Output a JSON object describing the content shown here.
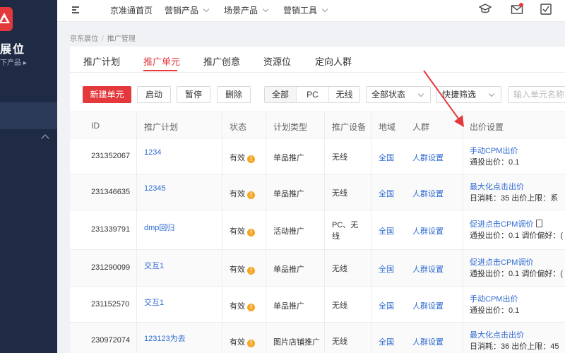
{
  "sidebar": {
    "brand_title": "展位",
    "brand_sub": "下产品"
  },
  "topbar": {
    "nav": [
      "京准通首页",
      "营销产品",
      "场景产品",
      "营销工具"
    ]
  },
  "breadcrumb": {
    "root": "京东展位",
    "sep": "/",
    "current": "推广管理"
  },
  "tabs": [
    "推广计划",
    "推广单元",
    "推广创意",
    "资源位",
    "定向人群"
  ],
  "toolbar": {
    "new_unit": "新建单元",
    "start": "启动",
    "pause": "暂停",
    "delete": "删除",
    "device_segments": [
      "全部",
      "PC",
      "无线"
    ],
    "status_select": "全部状态",
    "quick_filter": "快捷筛选",
    "search_placeholder": "输入单元名称"
  },
  "table": {
    "headers": [
      "ID",
      "推广计划",
      "状态",
      "计划类型",
      "推广设备",
      "地域",
      "人群",
      "出价设置"
    ],
    "rows": [
      {
        "id": "231352067",
        "plan": "1234",
        "status": "有效",
        "type": "单品推广",
        "device": "无线",
        "region": "全国",
        "crowd": "人群设置",
        "bid": "手动CPM出价",
        "bid_sub": "通投出价：0.1"
      },
      {
        "id": "231346635",
        "plan": "12345",
        "status": "有效",
        "type": "单品推广",
        "device": "无线",
        "region": "全国",
        "crowd": "人群设置",
        "bid": "最大化点击出价",
        "bid_sub": "日消耗：35    出价上限：系"
      },
      {
        "id": "231339791",
        "plan": "dmp回归",
        "status": "有效",
        "type": "活动推广",
        "device": "PC、无线",
        "region": "全国",
        "crowd": "人群设置",
        "bid": "促进点击CPM调价",
        "bid_sub": "通投出价：0.1    调价偏好：("
      },
      {
        "id": "231290099",
        "plan": "交互1",
        "status": "有效",
        "type": "单品推广",
        "device": "无线",
        "region": "全国",
        "crowd": "人群设置",
        "bid": "促进点击CPM调价",
        "bid_sub": "通投出价：0.1    调价偏好：("
      },
      {
        "id": "231152570",
        "plan": "交互1",
        "status": "有效",
        "type": "单品推广",
        "device": "无线",
        "region": "全国",
        "crowd": "人群设置",
        "bid": "手动CPM出价",
        "bid_sub": "通投出价：0.1"
      },
      {
        "id": "230972074",
        "plan": "123123为去",
        "status": "有效",
        "type": "图片店铺推广",
        "device": "无线",
        "region": "全国",
        "crowd": "人群设置",
        "bid": "最大化点击出价",
        "bid_sub": "日消耗：36    出价上限：45"
      }
    ]
  },
  "colors": {
    "accent": "#e4393c",
    "link": "#2e6bd1",
    "warn": "#f5a623",
    "sidebar": "#1f2a44"
  },
  "icons": [
    "menu-icon",
    "graduation-cap-icon",
    "mail-icon",
    "checklist-icon",
    "warning-icon",
    "clipboard-icon",
    "red-arrow-annotation"
  ]
}
